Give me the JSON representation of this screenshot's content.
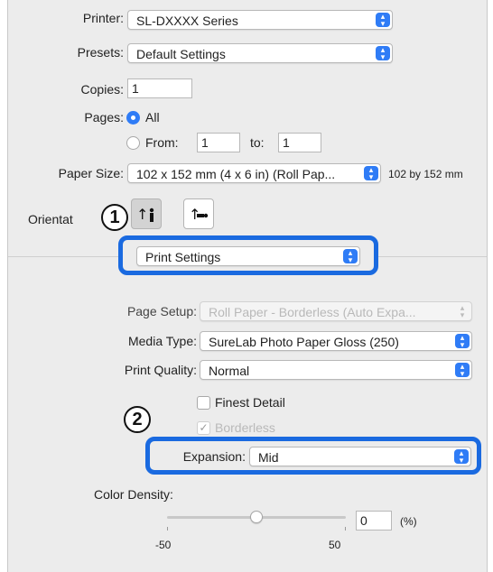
{
  "printer": {
    "label": "Printer:",
    "value": "SL-DXXXX Series"
  },
  "presets": {
    "label": "Presets:",
    "value": "Default Settings"
  },
  "copies": {
    "label": "Copies:",
    "value": "1"
  },
  "pages": {
    "label": "Pages:",
    "all_label": "All",
    "from_label": "From:",
    "from_value": "1",
    "to_label": "to:",
    "to_value": "1"
  },
  "paper_size": {
    "label": "Paper Size:",
    "value": "102 x 152 mm (4 x 6 in) (Roll Pap...",
    "dimensions": "102 by 152 mm"
  },
  "orientation": {
    "label": "Orientat"
  },
  "callouts": {
    "one": "1",
    "two": "2"
  },
  "section_popup": {
    "value": "Print Settings"
  },
  "page_setup": {
    "label": "Page Setup:",
    "value": "Roll Paper - Borderless (Auto Expa..."
  },
  "media_type": {
    "label": "Media Type:",
    "value": "SureLab Photo Paper Gloss (250)"
  },
  "print_quality": {
    "label": "Print Quality:",
    "value": "Normal"
  },
  "finest_detail": {
    "label": "Finest Detail",
    "checked": false
  },
  "borderless": {
    "label": "Borderless",
    "checked": true
  },
  "expansion": {
    "label": "Expansion:",
    "value": "Mid"
  },
  "color_density": {
    "label": "Color Density:",
    "value": "0",
    "unit": "(%)",
    "min_label": "-50",
    "max_label": "50",
    "slider_value": 0
  },
  "colors": {
    "accent": "#2f7cf6",
    "highlight": "#1a6ae0"
  }
}
